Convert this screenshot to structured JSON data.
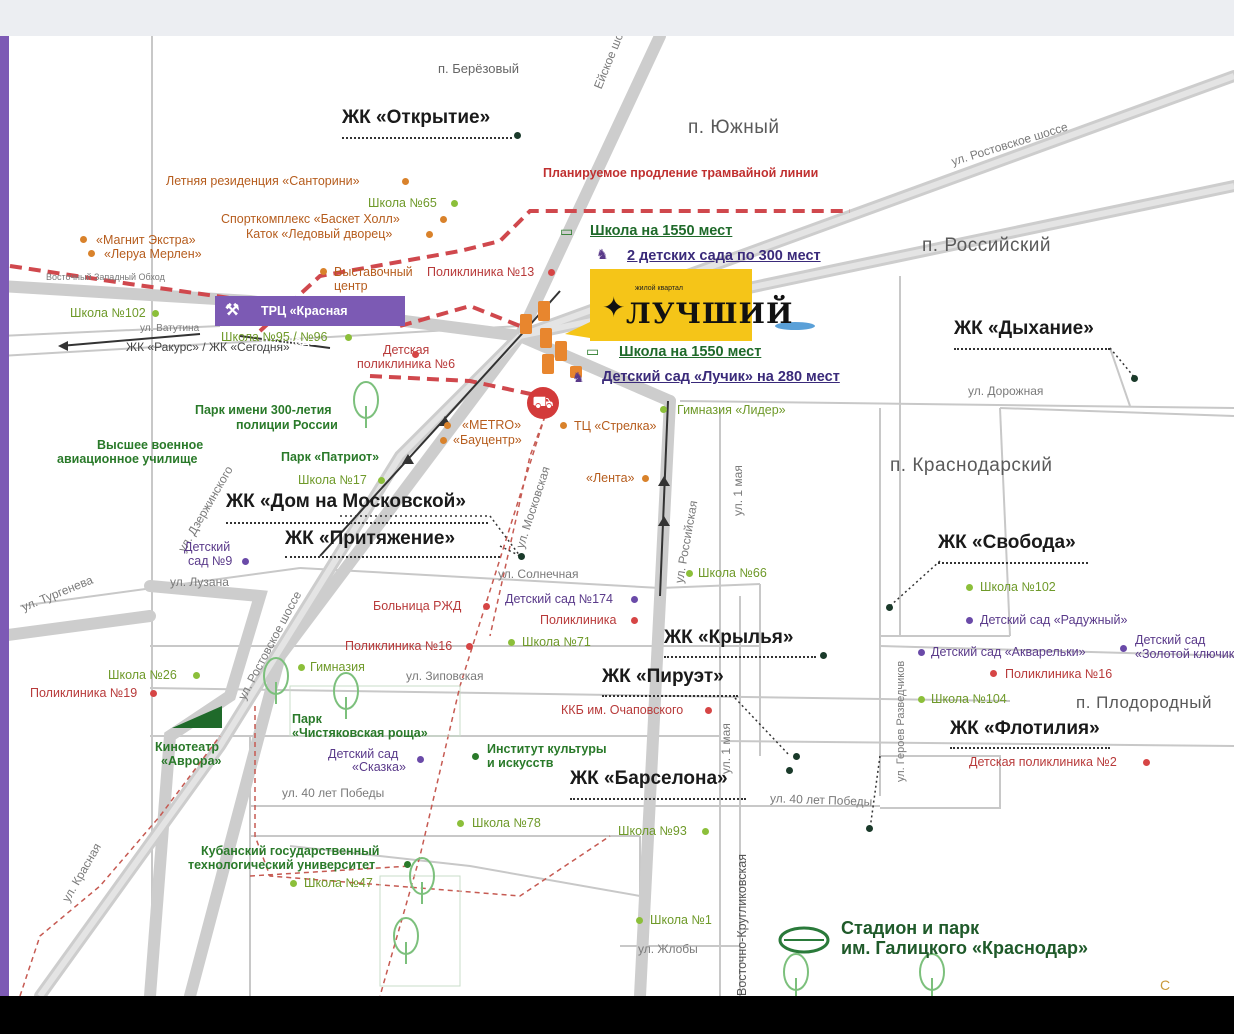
{
  "colors": {
    "purple": "#7d5ab5",
    "brand_yellow": "#f5c518",
    "tram_red": "#d33a3a",
    "school_green": "#8cbf3a",
    "kg_purple": "#6a4aa8",
    "poi_orange": "#d9822b",
    "hospital_red": "#d64545",
    "zhk_dark": "#1a3a2a"
  },
  "brand": {
    "small": "жилой квартал",
    "name": "ЛУЧШИЙ",
    "star": "✦"
  },
  "trc": {
    "label": "ТРЦ «Красная площадь»",
    "icon": "cannon-icon"
  },
  "areas": {
    "berezoviy": "п. Берёзовый",
    "yuzhny": "п. Южный",
    "rossiyskiy": "п. Российский",
    "krasnodarskiy": "п. Краснодарский",
    "plodorodny": "п. Плодородный"
  },
  "streets": {
    "eyskoe": "Ейское шоссе",
    "rostovskoe_ne": "ул. Ростовское шоссе",
    "bypass": "Восточный Западный Обход",
    "vatutina": "ул. Ватутина",
    "rakurs": "ЖК «Ракурс» / ЖК «Сегодня»",
    "dzerzhinskogo": "ул. Дзержинского",
    "turgeneva": "ул. Тургенева",
    "luzana": "ул. Лузана",
    "rostovskoe_sw": "ул. Ростовское шоссе",
    "moskovskaya": "ул. Московская",
    "solnechnaya": "ул. Солнечная",
    "rossiyskaya": "ул. Российская",
    "may1": "ул. 1 мая",
    "may1_s": "ул. 1 мая",
    "dorozhnaya": "ул. Дорожная",
    "zipovskaya": "ул. Зиповская",
    "pobedy_w": "ул. 40 лет Победы",
    "pobedy_e": "ул. 40 лет Победы",
    "geroev": "ул. Героев Разведчиков",
    "zhloby": "ул. Жлобы",
    "krasnaya": "ул. Красная",
    "vostochno": "Восточно-Кругликовская"
  },
  "tram_plan": "Планируемое продление трамвайной линии",
  "features": {
    "school1": "Школа на 1550 мест",
    "kg1": "2 детских сада по 300 мест",
    "school2": "Школа  на 1550 мест",
    "kg2": "Детский сад «Лучик» на 280 мест"
  },
  "zhk": {
    "otkrytie": "ЖК «Открытие»",
    "dyhanie": "ЖК «Дыхание»",
    "dom_moskovskoy": "ЖК «Дом на Московской»",
    "prityazhenie": "ЖК «Притяжение»",
    "svoboda": "ЖК «Свобода»",
    "krylya": "ЖК «Крылья»",
    "piruet": "ЖК «Пируэт»",
    "flotiliya": "ЖК «Флотилия»",
    "barselona": "ЖК «Барселона»"
  },
  "poi": {
    "santorini": "Летняя резиденция «Санторини»",
    "school65": "Школа №65",
    "basket": "Спорткомплекс «Баскет Холл»",
    "katok": "Каток «Ледовый дворец»",
    "magnit": "«Магнит Экстра»",
    "leroy": "«Леруа Мерлен»",
    "vystavochny": "Выставочный",
    "vystavochny2": "центр",
    "poliklinika13": "Поликлиника №13",
    "school102w": "Школа №102",
    "school95": "Школа №95 / №96",
    "det_pol6a": "Детская",
    "det_pol6b": "поликлиника №6",
    "park300a": "Парк имени 300-летия",
    "park300b": "полиции России",
    "metro": "«METRO»",
    "baucentr": "«Бауцентр»",
    "strelka": "ТЦ «Стрелка»",
    "gimnaziya_lider": "Гимназия «Лидер»",
    "vvaua": "Высшее военное",
    "vvaub": "авиационное училище",
    "patriot": "Парк «Патриот»",
    "school17": "Школа №17",
    "lenta": "«Лента»",
    "det9a": "Детский",
    "det9b": "сад №9",
    "school66": "Школа №66",
    "school102e": "Школа №102",
    "raduzhny": "Детский сад «Радужный»",
    "bolnica": "Больница РЖД",
    "ds174": "Детский сад №174",
    "poliklinika_c": "Поликлиника",
    "akvarelki": "Детский сад «Акварельки»",
    "zolotoy1": "Детский сад",
    "zolotoy2": "«Золотой ключик»",
    "pol16e": "Поликлиника №16",
    "pol16w": "Поликлиника №16",
    "school71": "Школа №71",
    "school104": "Школа №104",
    "school26": "Школа №26",
    "gimnaziya": "Гимназия",
    "pol19": "Поликлиника №19",
    "parka": "Парк",
    "parkb": "«Чистяковская роща»",
    "kkb": "ККБ им. Очаповского",
    "skazkaa": "Детский сад",
    "skazkab": "«Сказка»",
    "instituta": "Институт культуры",
    "institutb": "и искусств",
    "avroraa": "Кинотеатр",
    "avrorab": "«Аврора»",
    "det_pol2": "Детская поликлиника №2",
    "school78": "Школа №78",
    "school93": "Школа №93",
    "kubgtua": "Кубанский государственный",
    "kubgtub": "технологический университет",
    "school47": "Школа №47",
    "school1": "Школа №1",
    "stadiona": "Стадион и парк",
    "stadionb": "им. Галицкого «Краснодар»"
  },
  "corner": "С"
}
